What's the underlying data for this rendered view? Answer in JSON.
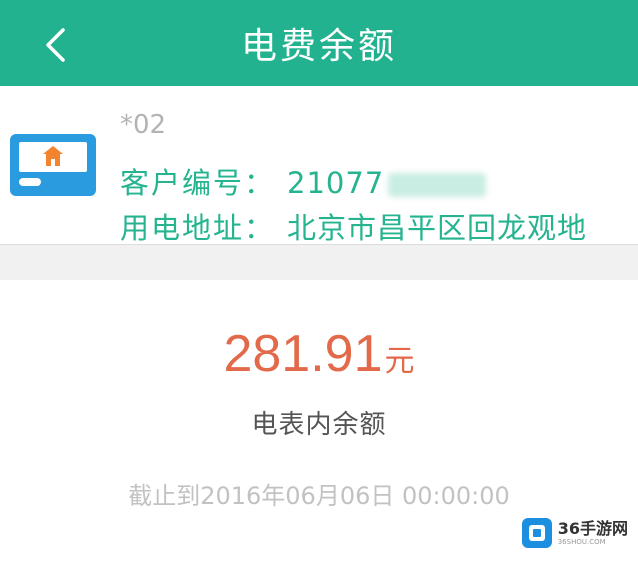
{
  "header": {
    "title": "电费余额",
    "back_icon": "chevron-left-icon"
  },
  "account": {
    "id_suffix": "*02",
    "customer_no_label": "客户编号：",
    "customer_no_value": "21077",
    "address_label": "用电地址：",
    "address_value": "北京市昌平区回龙观地"
  },
  "balance": {
    "amount": "281.91",
    "unit": "元",
    "label": "电表内余额",
    "as_of": "截止到2016年06月06日 00:00:00"
  },
  "watermark": {
    "text": "36手游网",
    "sub": "36SHOU.COM"
  },
  "colors": {
    "header_bg": "#23b28f",
    "accent_green": "#25b48f",
    "amount": "#e26a4a",
    "icon_blue": "#2b9be0",
    "icon_orange": "#f2832f"
  }
}
